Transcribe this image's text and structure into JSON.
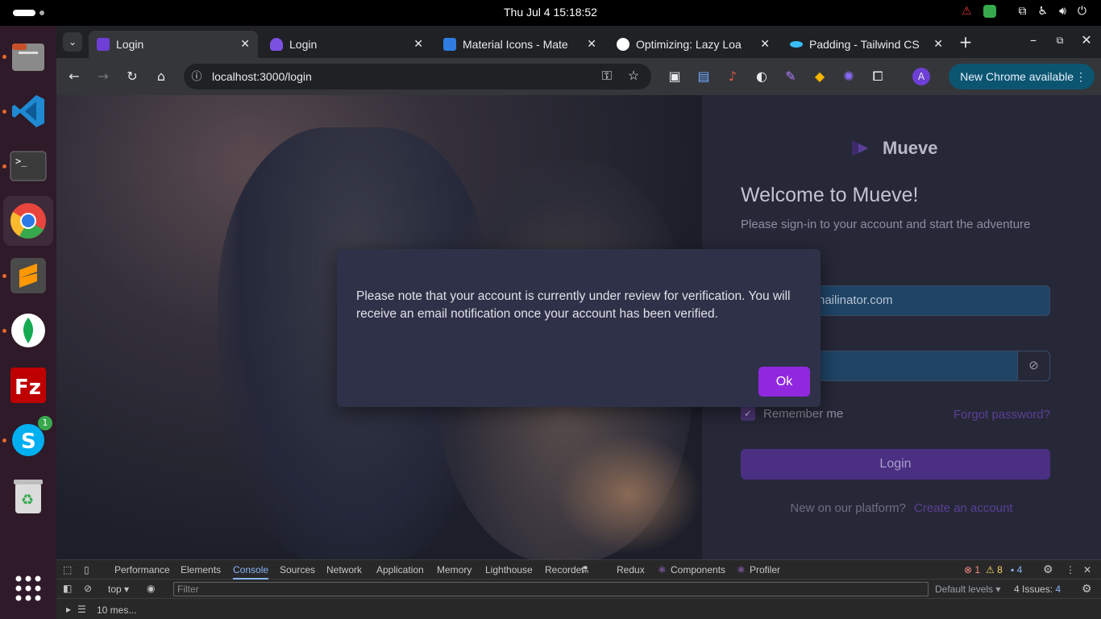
{
  "system_bar": {
    "clock": "Thu Jul 4  15:18:52",
    "tray_icons": [
      "warning-icon",
      "update-icon",
      "network-icon",
      "accessibility-icon",
      "volume-icon",
      "power-icon"
    ]
  },
  "dock": {
    "items": [
      {
        "name": "files",
        "color": "#8a8a8a"
      },
      {
        "name": "vscode",
        "color": "#1f8ad2"
      },
      {
        "name": "terminal",
        "color": "#3b3b3b"
      },
      {
        "name": "chrome",
        "color": "#e8453c"
      },
      {
        "name": "sublime",
        "color": "#e57f22"
      },
      {
        "name": "mongodb",
        "color": "#13aa52"
      },
      {
        "name": "filezilla",
        "color": "#bf0000"
      },
      {
        "name": "skype",
        "color": "#00aff0",
        "badge": "1"
      },
      {
        "name": "trash",
        "color": "#9a9a9a"
      }
    ]
  },
  "browser": {
    "tabs": [
      {
        "title": "Login",
        "favicon_color": "#6d3fd6",
        "active": true
      },
      {
        "title": "Login",
        "favicon_color": "#7b52e0",
        "active": false
      },
      {
        "title": "Material Icons - Mate",
        "favicon_color": "#2f7de1",
        "active": false
      },
      {
        "title": "Optimizing: Lazy Loa",
        "favicon_color": "#ffffff",
        "active": false
      },
      {
        "title": "Padding - Tailwind CS",
        "favicon_color": "#38bdf8",
        "active": false
      }
    ],
    "new_tab_label": "+",
    "url": "localhost:3000/login",
    "profile_initial": "A",
    "update_button": "New Chrome available"
  },
  "login_page": {
    "brand_name": "Mueve",
    "welcome_title": "Welcome to Mueve!",
    "subtitle": "Please sign-in to your account and start the adventure",
    "email_value": "nailinator.com",
    "remember_label": "Remember me",
    "forgot_link": "Forgot password?",
    "login_button": "Login",
    "new_platform_text": "New on our platform?",
    "create_account_link": "Create an account"
  },
  "modal": {
    "message": "Please note that your account is currently under review for verification. You will receive an email notification once your account has been verified.",
    "ok_button": "Ok"
  },
  "devtools": {
    "tabs": [
      "Performance",
      "Elements",
      "Console",
      "Sources",
      "Network",
      "Application",
      "Memory",
      "Lighthouse",
      "Recorder",
      "Redux",
      "Components",
      "Profiler"
    ],
    "active_tab": "Console",
    "errors": "1",
    "warnings": "8",
    "infos": "4",
    "context": "top",
    "filter_placeholder": "Filter",
    "levels": "Default levels",
    "issues_label": "4 Issues:",
    "issues_count": "4",
    "messages": "10 mes..."
  }
}
